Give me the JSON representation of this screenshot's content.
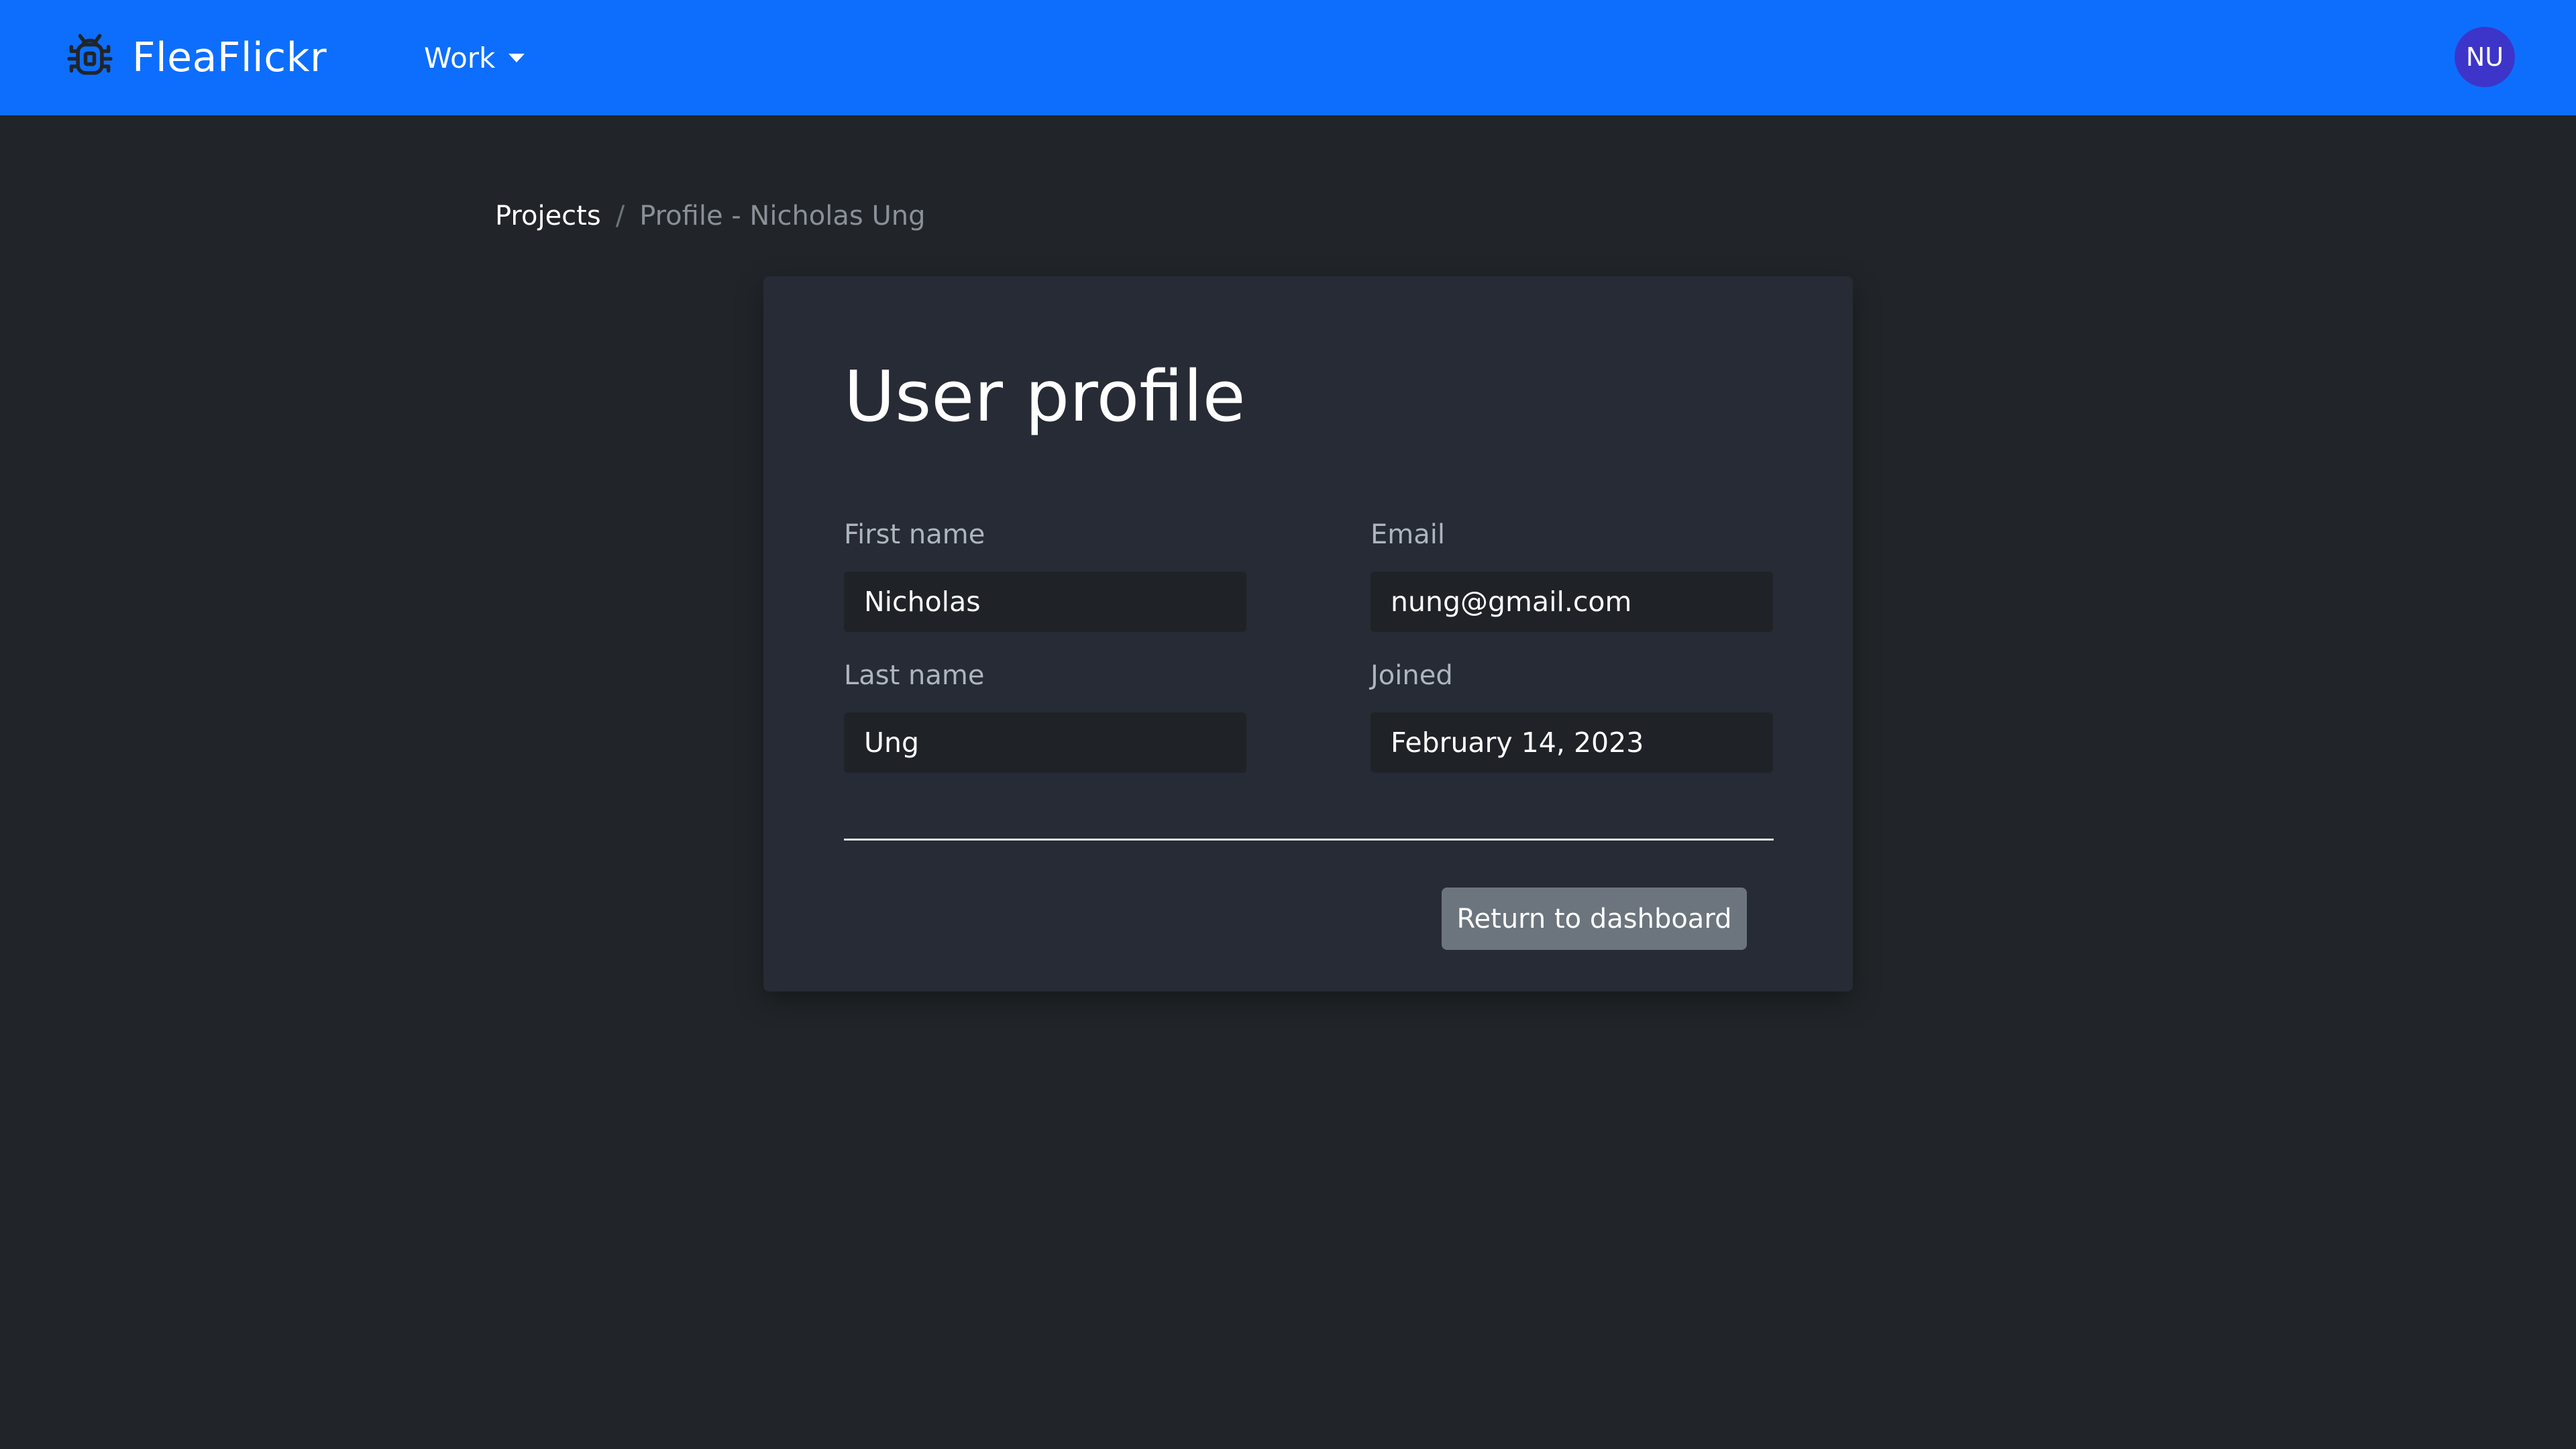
{
  "navbar": {
    "brand_name": "FleaFlickr",
    "brand_icon": "bug-icon",
    "dropdown_label": "Work",
    "avatar_initials": "NU",
    "bg_color": "#0d6efd",
    "avatar_color": "#3d35c9"
  },
  "breadcrumb": {
    "items": [
      {
        "label": "Projects"
      },
      {
        "label": "Profile - Nicholas Ung"
      }
    ],
    "separator": "/"
  },
  "profile": {
    "title": "User profile",
    "first_name": {
      "label": "First name",
      "value": "Nicholas"
    },
    "last_name": {
      "label": "Last name",
      "value": "Ung"
    },
    "email": {
      "label": "Email",
      "value": "nung@gmail.com"
    },
    "joined": {
      "label": "Joined",
      "value": "February 14, 2023"
    },
    "return_button": "Return to dashboard"
  },
  "theme": {
    "page_bg": "#212529",
    "card_bg": "#272b35",
    "input_bg": "#1f2227",
    "button_bg": "#6c757d"
  }
}
